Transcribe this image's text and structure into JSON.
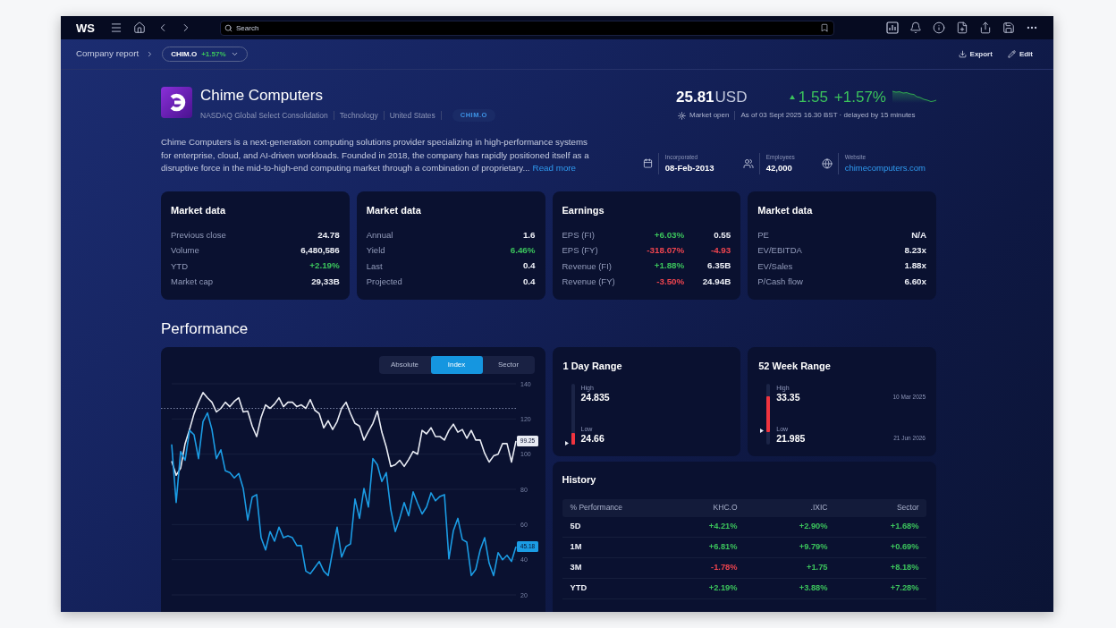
{
  "top_bar": {
    "logo": "WS",
    "search": {
      "placeholder": "Search"
    }
  },
  "breadcrumb": {
    "label": "Company report",
    "ticker": "CHIM.O",
    "change": "+1.57%",
    "actions": [
      {
        "kind": "export",
        "label": "Export"
      },
      {
        "kind": "edit",
        "label": "Edit"
      }
    ]
  },
  "company": {
    "name": "Chime Computers",
    "exchange": "NASDAQ Global Select Consolidation",
    "sector": "Technology",
    "country": "United States",
    "ticker": "CHIM.O",
    "description": "Chime Computers is a next-generation computing solutions provider specializing in high-performance systems for enterprise, cloud, and AI-driven workloads. Founded in 2018, the company has rapidly positioned itself as a disruptive force in the mid-to-high-end computing market through a combination of proprietary...",
    "read_more": "Read more",
    "facts": [
      {
        "kind": "incorporated",
        "label": "Incorporated",
        "value": "08-Feb-2013"
      },
      {
        "kind": "employees",
        "label": "Employees",
        "value": "42,000"
      },
      {
        "kind": "website",
        "label": "Website",
        "value": "chimecomputers.com"
      }
    ]
  },
  "quote": {
    "price": "25.81",
    "currency": "USD",
    "up": true,
    "change": "1.55",
    "change_pct": "+1.57%",
    "market_status": "Market open",
    "as_of": "As of 03 Sept 2025 16.30 BST · delayed by 15 minutes"
  },
  "cards": [
    {
      "title": "Market data",
      "rows": [
        {
          "label": "Previous close",
          "value": {
            "text": "24.78",
            "color": "#eef0f7"
          }
        },
        {
          "label": "Volume",
          "value": {
            "text": "6,480,586",
            "color": "#eef0f7"
          }
        },
        {
          "label": "YTD",
          "value": {
            "text": "+2.19%",
            "color": "#3bc35c"
          }
        },
        {
          "label": "Market cap",
          "value": {
            "text": "29,33B",
            "color": "#eef0f7"
          }
        }
      ]
    },
    {
      "title": "Market data",
      "rows": [
        {
          "label": "Annual",
          "value": {
            "text": "1.6",
            "color": "#eef0f7"
          }
        },
        {
          "label": "Yield",
          "value": {
            "text": "6.46%",
            "color": "#3bc35c"
          }
        },
        {
          "label": "Last",
          "value": {
            "text": "0.4",
            "color": "#eef0f7"
          }
        },
        {
          "label": "Projected",
          "value": {
            "text": "0.4",
            "color": "#eef0f7"
          }
        }
      ]
    },
    {
      "title": "Earnings",
      "rows": [
        {
          "label": "EPS (FI)",
          "change": {
            "text": "+6.03%",
            "color": "#3bc35c"
          },
          "value": {
            "text": "0.55",
            "color": "#eef0f7"
          }
        },
        {
          "label": "EPS (FY)",
          "change": {
            "text": "-318.07%",
            "color": "#f0454f"
          },
          "value": {
            "text": "-4.93",
            "color": "#f0454f"
          }
        },
        {
          "label": "Revenue (FI)",
          "change": {
            "text": "+1.88%",
            "color": "#3bc35c"
          },
          "value": {
            "text": "6.35B",
            "color": "#eef0f7"
          }
        },
        {
          "label": "Revenue (FY)",
          "change": {
            "text": "-3.50%",
            "color": "#f0454f"
          },
          "value": {
            "text": "24.94B",
            "color": "#eef0f7"
          }
        }
      ]
    },
    {
      "title": "Market data",
      "rows": [
        {
          "label": "PE",
          "value": {
            "text": "N/A",
            "color": "#eef0f7"
          }
        },
        {
          "label": "EV/EBITDA",
          "value": {
            "text": "8.23x",
            "color": "#eef0f7"
          }
        },
        {
          "label": "EV/Sales",
          "value": {
            "text": "1.88x",
            "color": "#eef0f7"
          }
        },
        {
          "label": "P/Cash flow",
          "value": {
            "text": "6.60x",
            "color": "#eef0f7"
          }
        }
      ]
    }
  ],
  "performance": {
    "title": "Performance",
    "views": [
      {
        "label": "Absolute",
        "selected": false
      },
      {
        "label": "Index",
        "selected": true
      },
      {
        "label": "Sector",
        "selected": false
      }
    ],
    "chart_data": {
      "type": "line",
      "ylim": [
        20,
        140
      ],
      "yticks": [
        20,
        40,
        60,
        80,
        100,
        120,
        140
      ],
      "grid": true,
      "series": [
        {
          "color": "#e8ebf3",
          "values": [
            96,
            88,
            92,
            106,
            114,
            123,
            129.5,
            135,
            132,
            129.5,
            124,
            126,
            129.5,
            127,
            130,
            132,
            124,
            124.5,
            116,
            110,
            121,
            128,
            126,
            128.5,
            132,
            127,
            129.5,
            129.5,
            127,
            128,
            126,
            131,
            125,
            123,
            115,
            119,
            114,
            118.5,
            126,
            129.5,
            123,
            117.5,
            116,
            108,
            113,
            117.5,
            124.5,
            112.5,
            104,
            93,
            94,
            96.5,
            93,
            97,
            101.5,
            100,
            113.5,
            111.5,
            115,
            110,
            110,
            108,
            113.5,
            117,
            112.5,
            114,
            109,
            113.5,
            108,
            108,
            100.5,
            95.5,
            99,
            100,
            106,
            106,
            95.5,
            107.5
          ]
        },
        {
          "color": "#1b9ce4",
          "values": [
            105.5,
            72.5,
            101.5,
            96.5,
            113.5,
            111,
            97.5,
            118.5,
            123.5,
            114,
            97.5,
            102.5,
            90.5,
            89.5,
            86.5,
            89,
            80.5,
            62.5,
            75.5,
            77,
            52.5,
            45.5,
            56,
            50.5,
            58.5,
            52.5,
            53.5,
            52.5,
            48,
            48,
            33.5,
            32,
            35.5,
            39,
            33.5,
            31,
            45,
            58.5,
            41.5,
            47.5,
            49,
            74.5,
            63.5,
            80.5,
            70,
            97.5,
            94,
            84.5,
            89.5,
            68.5,
            56,
            63.5,
            72.5,
            65,
            78.5,
            72,
            66,
            70,
            78,
            73.5,
            76,
            77,
            40.5,
            56.5,
            63.5,
            51.5,
            50,
            31,
            34.5,
            45.5,
            52.5,
            38,
            31,
            44,
            40,
            42.5,
            39,
            47.5
          ]
        }
      ],
      "ref_lines": [
        {
          "axis": "y",
          "value": 126
        }
      ],
      "annotations": [
        {
          "text": "99.25",
          "y": 107.5
        },
        {
          "text": "45.18",
          "y": 47.5
        }
      ]
    }
  },
  "ranges": [
    {
      "title": "1 Day Range",
      "kind": "base",
      "level": 0.18,
      "high_label": "High",
      "high": "24.835",
      "low_label": "Low",
      "low": "24.66"
    },
    {
      "title": "52 Week Range",
      "kind": "band",
      "level": 0.74,
      "high_label": "High",
      "high": "33.35",
      "high_date": "10 Mar 2025",
      "low_label": "Low",
      "low": "21.985",
      "low_date": "21 Jun 2026"
    }
  ],
  "history": {
    "title": "History",
    "columns": [
      "% Performance",
      "KHC.O",
      ".IXIC",
      "Sector"
    ],
    "rows": [
      {
        "cells": [
          {
            "text": "5D"
          },
          {
            "text": "+4.21%",
            "color": "#3bc35c"
          },
          {
            "text": "+2.90%",
            "color": "#3bc35c"
          },
          {
            "text": "+1.68%",
            "color": "#3bc35c"
          }
        ]
      },
      {
        "cells": [
          {
            "text": "1M"
          },
          {
            "text": "+6.81%",
            "color": "#3bc35c"
          },
          {
            "text": "+9.79%",
            "color": "#3bc35c"
          },
          {
            "text": "+0.69%",
            "color": "#3bc35c"
          }
        ]
      },
      {
        "cells": [
          {
            "text": "3M"
          },
          {
            "text": "-1.78%",
            "color": "#f0454f"
          },
          {
            "text": "+1.75",
            "color": "#3bc35c"
          },
          {
            "text": "+8.18%",
            "color": "#3bc35c"
          }
        ]
      },
      {
        "cells": [
          {
            "text": "YTD"
          },
          {
            "text": "+2.19%",
            "color": "#3bc35c"
          },
          {
            "text": "+3.88%",
            "color": "#3bc35c"
          },
          {
            "text": "+7.28%",
            "color": "#3bc35c"
          }
        ]
      }
    ]
  }
}
